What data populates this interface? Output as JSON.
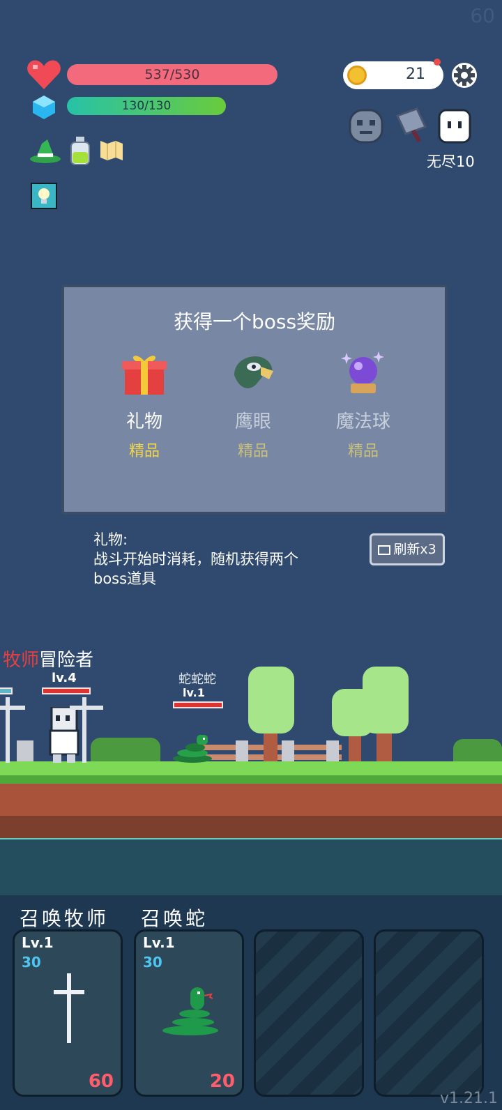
{
  "fps": "60",
  "hud": {
    "hp": "537/530",
    "mp": "130/130",
    "coins": "21",
    "mode": "无尽10"
  },
  "panel": {
    "title": "获得一个boss奖励",
    "rewards": [
      {
        "name": "礼物",
        "tier": "精品"
      },
      {
        "name": "鹰眼",
        "tier": "精品"
      },
      {
        "name": "魔法球",
        "tier": "精品"
      }
    ]
  },
  "description": {
    "title": "礼物:",
    "line1": "战斗开始时消耗，随机获得两个",
    "line2": "boss道具"
  },
  "refresh_label": "刷新x3",
  "battle": {
    "hero_role1": "牧师",
    "hero_role2": "冒险者",
    "hero_level": "lv.4",
    "enemy_name": "蛇蛇蛇",
    "enemy_level": "lv.1"
  },
  "summons": {
    "label1": "召唤牧师",
    "label2": "召唤蛇"
  },
  "cards": [
    {
      "lv": "Lv.1",
      "cost": "30",
      "num": "60",
      "icon": "cross-icon"
    },
    {
      "lv": "Lv.1",
      "cost": "30",
      "num": "20",
      "icon": "snake-icon"
    }
  ],
  "version": "v1.21.1",
  "colors": {
    "background": "#2f4a6e",
    "hp_bar": "#f26a7b",
    "tier_gold": "#f1d54a",
    "card_number": "#ff5c6c",
    "card_cost": "#4fc5f0"
  }
}
